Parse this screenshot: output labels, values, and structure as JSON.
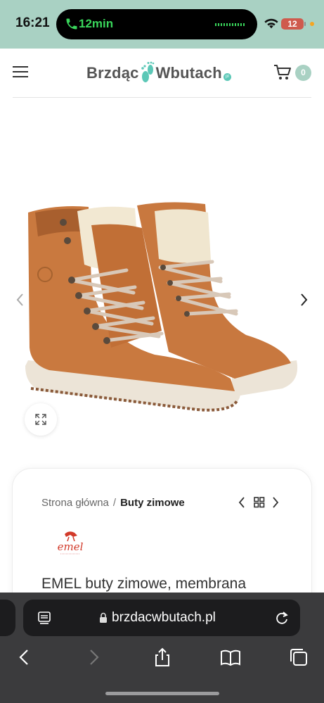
{
  "status_bar": {
    "time": "16:21",
    "call_duration": "12min",
    "battery_level": "12",
    "icons": [
      "phone-icon",
      "wifi-icon",
      "battery-icon"
    ],
    "background_color": "#a9d1c3"
  },
  "header": {
    "logo_part1": "Brzdąc",
    "logo_part2": "Wbutach",
    "logo_badge": "pl",
    "cart_count": "0",
    "icons": [
      "menu-icon",
      "cart-icon"
    ],
    "accent_color": "#5cc8b7"
  },
  "gallery": {
    "icons": [
      "chevron-left-icon",
      "chevron-right-icon",
      "expand-icon"
    ]
  },
  "product": {
    "breadcrumb_home": "Strona główna",
    "breadcrumb_separator": "/",
    "breadcrumb_current": "Buty zimowe",
    "title": "EMEL buty zimowe, membrana",
    "brand_logo_text": "emel"
  },
  "browser": {
    "url": "brzdacwbutach.pl",
    "icons": [
      "reader-icon",
      "lock-icon",
      "reload-icon",
      "back-icon",
      "forward-icon",
      "share-icon",
      "bookmarks-icon",
      "tabs-icon"
    ]
  }
}
